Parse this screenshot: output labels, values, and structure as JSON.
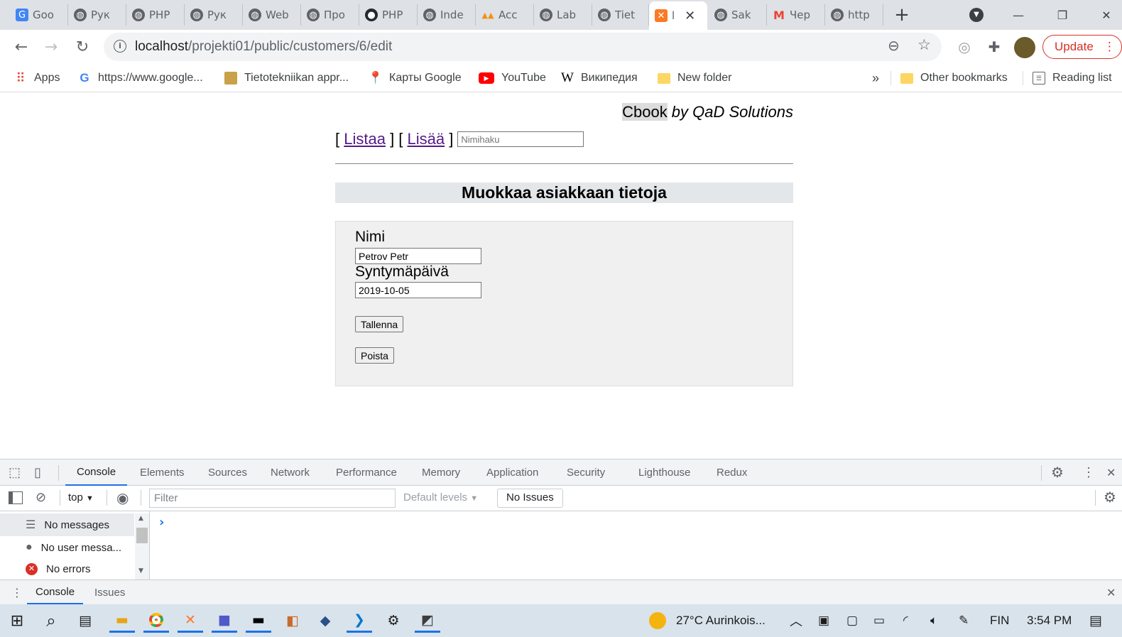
{
  "browser": {
    "tabs": [
      {
        "label": "Goo",
        "icon": "google-translate-icon"
      },
      {
        "label": "Рук",
        "icon": "globe-icon"
      },
      {
        "label": "PHP",
        "icon": "globe-icon"
      },
      {
        "label": "Рук",
        "icon": "globe-icon"
      },
      {
        "label": "Web",
        "icon": "globe-icon"
      },
      {
        "label": "Про",
        "icon": "globe-icon"
      },
      {
        "label": "PHP",
        "icon": "github-icon"
      },
      {
        "label": "Inde",
        "icon": "globe-icon"
      },
      {
        "label": "Acc",
        "icon": "phpmyadmin-icon"
      },
      {
        "label": "Lab",
        "icon": "globe-icon"
      },
      {
        "label": "Tiet",
        "icon": "globe-icon"
      },
      {
        "label": "l",
        "icon": "xampp-icon"
      },
      {
        "label": "Sak",
        "icon": "globe-icon"
      },
      {
        "label": "Чер",
        "icon": "gmail-icon"
      },
      {
        "label": "http",
        "icon": "globe-icon"
      }
    ],
    "new_tab_label": "+",
    "url_host": "localhost",
    "url_path": "/projekti01/public/customers/6/edit",
    "update_label": "Update"
  },
  "bookmarks": [
    {
      "label": "Apps"
    },
    {
      "label": "https://www.google..."
    },
    {
      "label": "Tietotekniikan appr..."
    },
    {
      "label": "Карты Google"
    },
    {
      "label": "YouTube"
    },
    {
      "label": "Википедия"
    },
    {
      "label": "New folder"
    }
  ],
  "bookmarks_overflow": "»",
  "other_bookmarks": "Other bookmarks",
  "reading_list": "Reading list",
  "page": {
    "brand_name": "Cbook",
    "brand_by": " by QaD Solutions",
    "nav": {
      "open1": "[ ",
      "list_link": "Listaa",
      "mid": " ] [ ",
      "add_link": "Lisää",
      "close": " ]",
      "search_placeholder": "Nimihaku"
    },
    "heading": "Muokkaa asiakkaan tietoja",
    "form": {
      "name_label": "Nimi",
      "name_value": "Petrov Petr",
      "birthday_label": "Syntymäpäivä",
      "birthday_value": "2019-10-05",
      "save_label": "Tallenna",
      "delete_label": "Poista"
    }
  },
  "devtools": {
    "tabs": [
      "Console",
      "Elements",
      "Sources",
      "Network",
      "Performance",
      "Memory",
      "Application",
      "Security",
      "Lighthouse",
      "Redux"
    ],
    "context": "top",
    "filter_placeholder": "Filter",
    "levels": "Default levels",
    "issues": "No Issues",
    "sidebar": [
      "No messages",
      "No user messa...",
      "No errors"
    ],
    "prompt": "›",
    "drawer_tabs": [
      "Console",
      "Issues"
    ]
  },
  "taskbar": {
    "weather": "27°C  Aurinkois...",
    "lang": "FIN",
    "time": "3:54 PM"
  }
}
